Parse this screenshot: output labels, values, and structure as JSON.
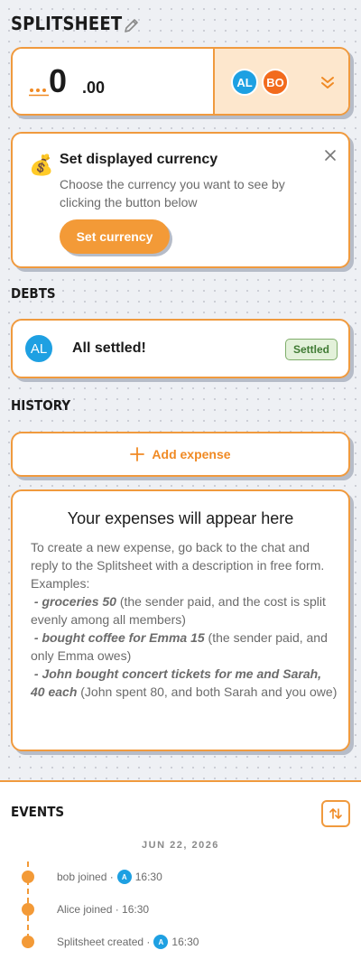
{
  "header": {
    "title": "SPLITSHEET"
  },
  "balance": {
    "main": "0",
    "decimals": ".00",
    "members": [
      {
        "initials": "AL",
        "color": "#1ea0e2"
      },
      {
        "initials": "BO",
        "color": "#f26b1d"
      }
    ]
  },
  "currency_prompt": {
    "icon": "💰",
    "title": "Set displayed currency",
    "description": "Choose the currency you want to see by clicking the button below",
    "button": "Set currency"
  },
  "debts": {
    "section_title": "DEBTS",
    "row": {
      "initials": "AL",
      "text": "All settled!",
      "badge": "Settled"
    }
  },
  "history": {
    "section_title": "HISTORY",
    "add_button": "Add expense",
    "empty_title": "Your expenses will appear here",
    "empty_intro": "To create a new expense, go back to the chat and reply to the Splitsheet with a description in free form.",
    "examples_label": "Examples:",
    "examples": [
      {
        "cmd": "- groceries 50",
        "desc": " (the sender paid, and the cost is split evenly among all members)"
      },
      {
        "cmd": "- bought coffee for Emma 15",
        "desc": " (the sender paid, and only Emma owes)"
      },
      {
        "cmd": "- John bought concert tickets for me and Sarah, 40 each",
        "desc": " (John spent 80, and both Sarah and you owe)"
      }
    ]
  },
  "events": {
    "section_title": "EVENTS",
    "date": "JUN 22, 2026",
    "items": [
      {
        "text": "bob joined ·",
        "avatar": "A",
        "time": "16:30"
      },
      {
        "text": "Alice joined · 16:30",
        "avatar": "",
        "time": ""
      },
      {
        "text": "Splitsheet created ·",
        "avatar": "A",
        "time": "16:30"
      }
    ]
  }
}
